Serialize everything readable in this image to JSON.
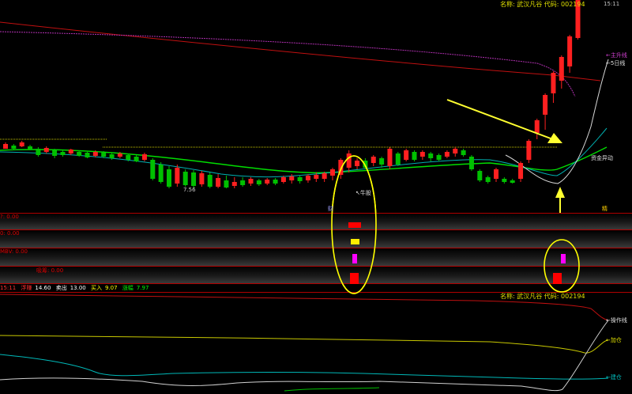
{
  "colors": {
    "background": "#000000",
    "up": "#ff2020",
    "down": "#00c000",
    "ma_yellow": "#e0e000",
    "ma_green": "#00e000",
    "ma_cyan": "#00c0c0",
    "ma_magenta": "#c000c0",
    "ma_white": "#e0e0e0",
    "arrow": "#ffff30"
  },
  "main_chart": {
    "header": "名称: 武汉凡谷 代码: 002194",
    "time": "15:11",
    "low_price_label": "7.56",
    "annotations": {
      "bull_label": "↖牛股",
      "fund_label": "资金异动",
      "left_small": "财",
      "right_small": "精"
    },
    "legend": {
      "main_rise": "←主升线",
      "ma5": "←5日线"
    }
  },
  "indicator_panels": {
    "p1_label": "?: 0.00",
    "p2_label": "0: 0.00",
    "p3_label": "MBV: 0.00",
    "p4_label": "吸筹: 0.00"
  },
  "status_bar": {
    "time": "15:11",
    "items": [
      {
        "label": "浮赚",
        "value": "14.60"
      },
      {
        "label": "卖出",
        "value": "13.00"
      },
      {
        "label": "买入",
        "value": "9.07"
      },
      {
        "label": "涨幅",
        "value": "7.97"
      }
    ]
  },
  "lower_chart": {
    "header": "名称: 武汉凡谷 代码: 002194",
    "legend": {
      "operate": "←操作线",
      "add": "←加仓",
      "build": "←建仓"
    }
  },
  "chart_data": {
    "type": "candlestick",
    "title": "",
    "candles": [
      [
        "u",
        180,
        188,
        182,
        188
      ],
      [
        "d",
        182,
        189,
        184,
        188
      ],
      [
        "u",
        178,
        186,
        180,
        185
      ],
      [
        "d",
        183,
        190,
        185,
        189
      ],
      [
        "d",
        186,
        198,
        188,
        196
      ],
      [
        "u",
        185,
        194,
        187,
        192
      ],
      [
        "d",
        188,
        200,
        190,
        197
      ],
      [
        "d",
        190,
        198,
        192,
        196
      ],
      [
        "u",
        188,
        196,
        189,
        194
      ],
      [
        "d",
        190,
        198,
        192,
        197
      ],
      [
        "d",
        192,
        200,
        193,
        199
      ],
      [
        "u",
        190,
        199,
        192,
        197
      ],
      [
        "d",
        191,
        200,
        193,
        198
      ],
      [
        "d",
        193,
        202,
        195,
        200
      ],
      [
        "u",
        192,
        200,
        194,
        198
      ],
      [
        "d",
        194,
        204,
        196,
        202
      ],
      [
        "d",
        196,
        205,
        198,
        204
      ],
      [
        "u",
        193,
        204,
        195,
        202
      ],
      [
        "d",
        200,
        228,
        202,
        226
      ],
      [
        "d",
        205,
        232,
        208,
        230
      ],
      [
        "d",
        210,
        238,
        214,
        236
      ],
      [
        "u",
        208,
        236,
        212,
        232
      ],
      [
        "d",
        214,
        236,
        217,
        234
      ],
      [
        "d",
        215,
        238,
        218,
        235
      ],
      [
        "u",
        216,
        236,
        219,
        233
      ],
      [
        "d",
        218,
        238,
        221,
        236
      ],
      [
        "u",
        220,
        238,
        225,
        236
      ],
      [
        "d",
        222,
        238,
        228,
        237
      ],
      [
        "u",
        224,
        238,
        230,
        235
      ],
      [
        "d",
        224,
        236,
        228,
        234
      ],
      [
        "u",
        224,
        235,
        226,
        232
      ],
      [
        "d",
        226,
        235,
        228,
        233
      ],
      [
        "u",
        225,
        234,
        227,
        232
      ],
      [
        "d",
        225,
        234,
        227,
        232
      ],
      [
        "u",
        222,
        232,
        224,
        230
      ],
      [
        "u",
        220,
        232,
        223,
        228
      ],
      [
        "d",
        222,
        232,
        224,
        229
      ],
      [
        "u",
        220,
        231,
        222,
        228
      ],
      [
        "u",
        218,
        230,
        221,
        226
      ],
      [
        "u",
        217,
        230,
        219,
        226
      ],
      [
        "u",
        212,
        228,
        214,
        222
      ],
      [
        "u",
        200,
        226,
        202,
        221
      ],
      [
        "u",
        190,
        218,
        194,
        212
      ],
      [
        "u",
        200,
        214,
        203,
        210
      ],
      [
        "d",
        200,
        214,
        203,
        212
      ],
      [
        "u",
        196,
        210,
        198,
        206
      ],
      [
        "d",
        198,
        212,
        200,
        208
      ],
      [
        "u",
        186,
        214,
        188,
        210
      ],
      [
        "d",
        192,
        210,
        194,
        208
      ],
      [
        "u",
        188,
        204,
        190,
        202
      ],
      [
        "d",
        190,
        204,
        192,
        202
      ],
      [
        "u",
        190,
        202,
        192,
        198
      ],
      [
        "d",
        192,
        204,
        194,
        200
      ],
      [
        "d",
        194,
        204,
        196,
        202
      ],
      [
        "u",
        190,
        200,
        192,
        198
      ],
      [
        "u",
        186,
        198,
        188,
        194
      ],
      [
        "d",
        188,
        198,
        190,
        196
      ],
      [
        "d",
        196,
        216,
        198,
        214
      ],
      [
        "d",
        214,
        230,
        216,
        228
      ],
      [
        "d",
        222,
        232,
        224,
        230
      ],
      [
        "u",
        212,
        230,
        214,
        226
      ],
      [
        "d",
        224,
        232,
        226,
        230
      ],
      [
        "d",
        226,
        232,
        228,
        231
      ],
      [
        "u",
        204,
        230,
        206,
        226
      ],
      [
        "u",
        176,
        206,
        178,
        202
      ],
      [
        "u",
        150,
        176,
        152,
        168
      ],
      [
        "u",
        118,
        164,
        120,
        145
      ],
      [
        "u",
        90,
        130,
        92,
        118
      ],
      [
        "u",
        70,
        112,
        72,
        102
      ],
      [
        "u",
        44,
        92,
        46,
        84
      ],
      [
        "u",
        0,
        50,
        0,
        48
      ]
    ],
    "volume_marks": [
      {
        "color": "#ff0000",
        "value": 1
      },
      {
        "color": "#ffee00",
        "value": 1
      },
      {
        "color": "#ff00ff",
        "value": 1
      },
      {
        "color": "#ff0000",
        "value": 1
      }
    ]
  }
}
